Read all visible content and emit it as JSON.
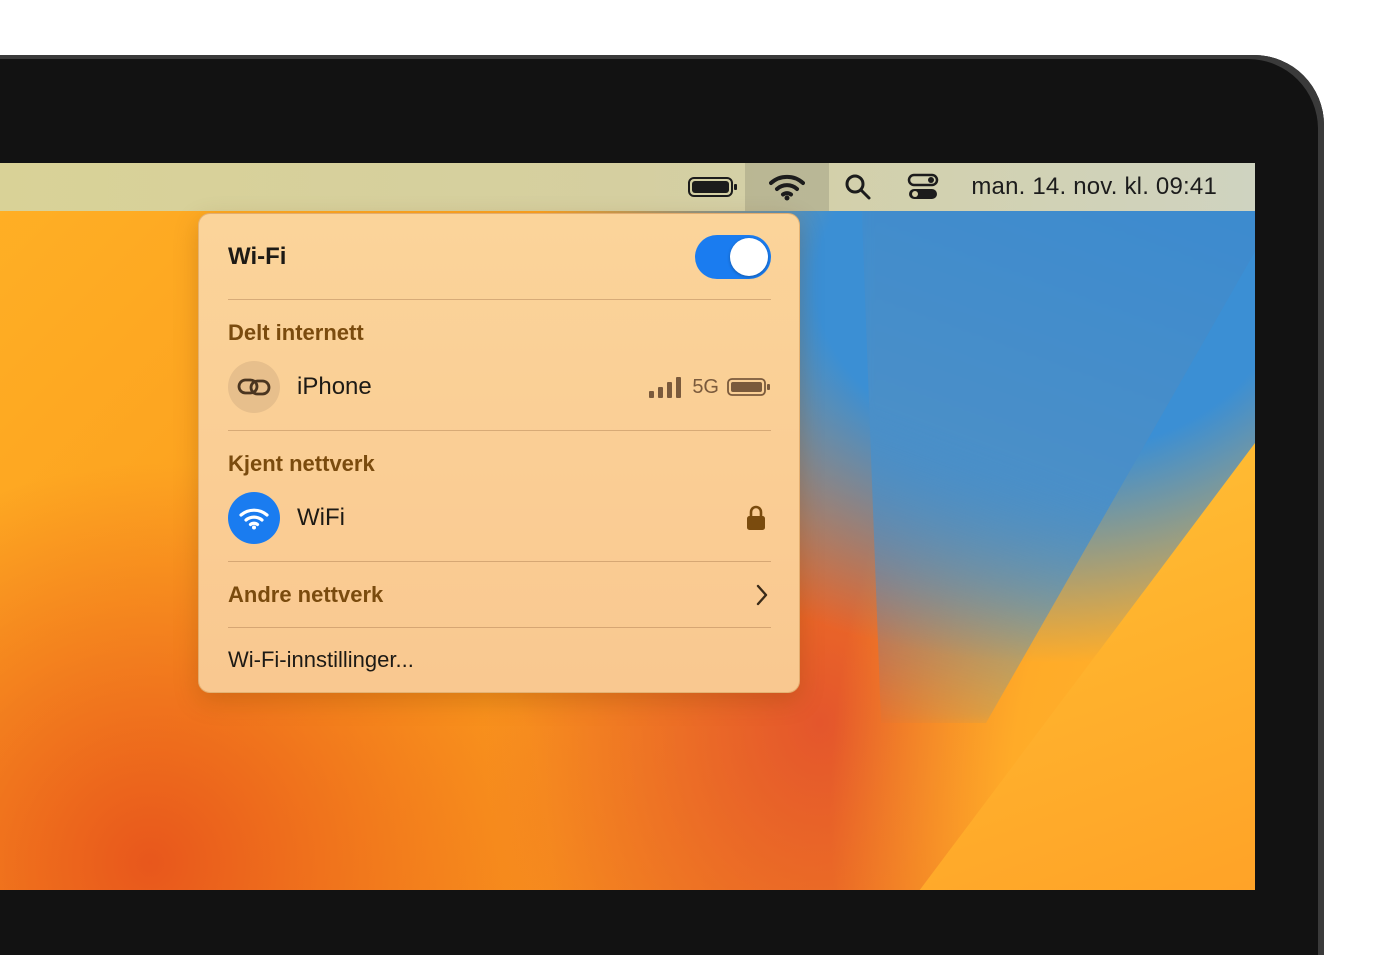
{
  "menubar": {
    "clock": "man. 14. nov. kl. 09:41",
    "icons": [
      "battery-icon",
      "wifi-icon",
      "search-icon",
      "control-center-icon"
    ]
  },
  "wifi_panel": {
    "title": "Wi-Fi",
    "wifi_enabled": true,
    "personal_hotspot": {
      "section_label": "Delt internett",
      "device_name": "iPhone",
      "network_type": "5G",
      "signal_bars": 4
    },
    "known_network": {
      "section_label": "Kjent nettverk",
      "network_name": "WiFi",
      "secured": true
    },
    "other_networks_label": "Andre nettverk",
    "settings_label": "Wi-Fi-innstillinger..."
  },
  "colors": {
    "accent": "#1a7cf0",
    "section_text": "#7a4b0e"
  }
}
